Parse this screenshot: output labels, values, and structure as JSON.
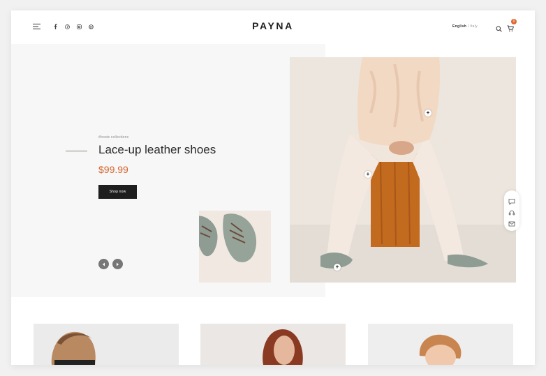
{
  "header": {
    "logo": "PAYNA",
    "language": {
      "active": "English",
      "separator": "/",
      "other": "Italy"
    },
    "cart_count": "0",
    "social_icons": [
      "facebook-icon",
      "pinterest-icon",
      "instagram-icon",
      "github-icon"
    ]
  },
  "hero": {
    "kicker": "#boots collections",
    "title": "Lace-up leather shoes",
    "price": "$99.99",
    "cta": "Shop now"
  },
  "side_bar_icons": [
    "chat-icon",
    "support-icon",
    "mail-icon"
  ],
  "colors": {
    "accent": "#d4622a",
    "dark": "#1e1e1e",
    "hero_bg": "#f7f7f7"
  }
}
